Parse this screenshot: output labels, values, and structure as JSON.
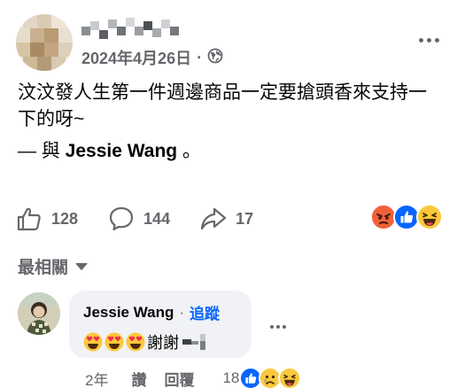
{
  "post": {
    "date": "2024年4月26日",
    "date_sep": "·",
    "audience_icon": "globe-icon",
    "text": "汶汶發人生第一件週邊商品一定要搶頭香來支持一下的呀~",
    "tag_prefix": "— 與 ",
    "tag_name": "Jessie Wang",
    "tag_suffix": " 。"
  },
  "actions": {
    "likes": "128",
    "comments": "144",
    "shares": "17"
  },
  "reactions_top": [
    "angry-icon",
    "like-icon",
    "haha-icon"
  ],
  "sort": {
    "label": "最相關",
    "icon": "caret-down-icon"
  },
  "comment": {
    "author": "Jessie Wang",
    "sep": "·",
    "follow": "追蹤",
    "emojis": [
      "heart-eyes-icon",
      "heart-eyes-icon",
      "heart-eyes-icon"
    ],
    "text": "謝謝",
    "time": "2年",
    "like_label": "讚",
    "reply_label": "回覆",
    "reaction_count": "18",
    "reactions": [
      "like-icon",
      "sad-icon",
      "haha-icon"
    ]
  },
  "colors": {
    "accent": "#0866ff",
    "secondary_text": "#65676b",
    "bubble_bg": "#f0f2f5"
  }
}
